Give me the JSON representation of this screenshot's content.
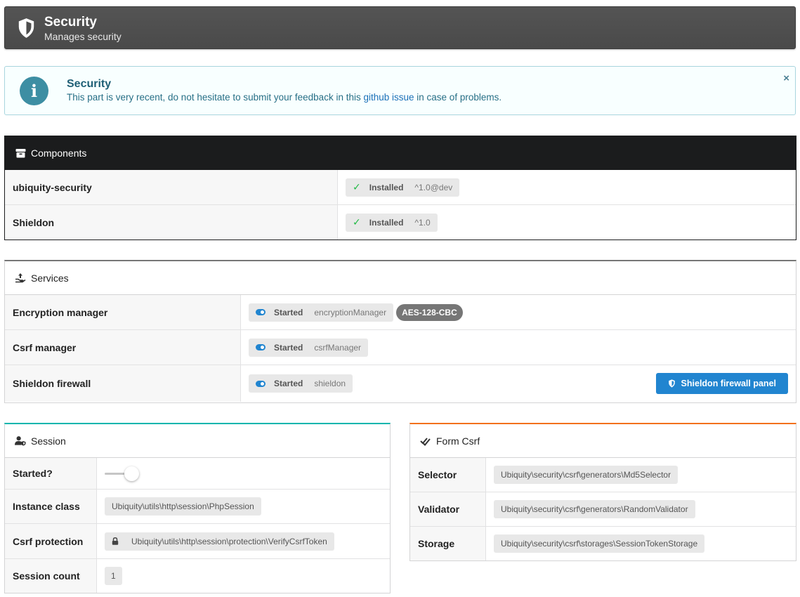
{
  "header": {
    "title": "Security",
    "subtitle": "Manages security",
    "icon": "shield-icon"
  },
  "info": {
    "title": "Security",
    "text_before": "This part is very recent, do not hesitate to submit your feedback in this ",
    "link": "github issue",
    "text_after": " in case of problems.",
    "close": "×"
  },
  "components": {
    "title": "Components",
    "rows": [
      {
        "label": "ubiquity-security",
        "status": "Installed",
        "version": "^1.0@dev"
      },
      {
        "label": "Shieldon",
        "status": "Installed",
        "version": "^1.0"
      }
    ]
  },
  "services": {
    "title": "Services",
    "rows": [
      {
        "label": "Encryption manager",
        "status": "Started",
        "name": "encryptionManager",
        "badge": "AES-128-CBC"
      },
      {
        "label": "Csrf manager",
        "status": "Started",
        "name": "csrfManager"
      },
      {
        "label": "Shieldon firewall",
        "status": "Started",
        "name": "shieldon",
        "button": "Shieldon firewall panel"
      }
    ]
  },
  "session": {
    "title": "Session",
    "rows": [
      {
        "label": "Started?",
        "value": ""
      },
      {
        "label": "Instance class",
        "value": "Ubiquity\\utils\\http\\session\\PhpSession"
      },
      {
        "label": "Csrf protection",
        "value": "Ubiquity\\utils\\http\\session\\protection\\VerifyCsrfToken"
      },
      {
        "label": "Session count",
        "value": "1"
      }
    ],
    "started": false
  },
  "formcsrf": {
    "title": "Form Csrf",
    "rows": [
      {
        "label": "Selector",
        "value": "Ubiquity\\security\\csrf\\generators\\Md5Selector"
      },
      {
        "label": "Validator",
        "value": "Ubiquity\\security\\csrf\\generators\\RandomValidator"
      },
      {
        "label": "Storage",
        "value": "Ubiquity\\security\\csrf\\storages\\SessionTokenStorage"
      }
    ]
  },
  "colors": {
    "header_bg": "#4e4e4e",
    "components_head": "#1b1c1d",
    "session_accent": "#00b5ad",
    "formcsrf_accent": "#f2711c",
    "primary": "#2185d0",
    "success": "#21ba45"
  }
}
